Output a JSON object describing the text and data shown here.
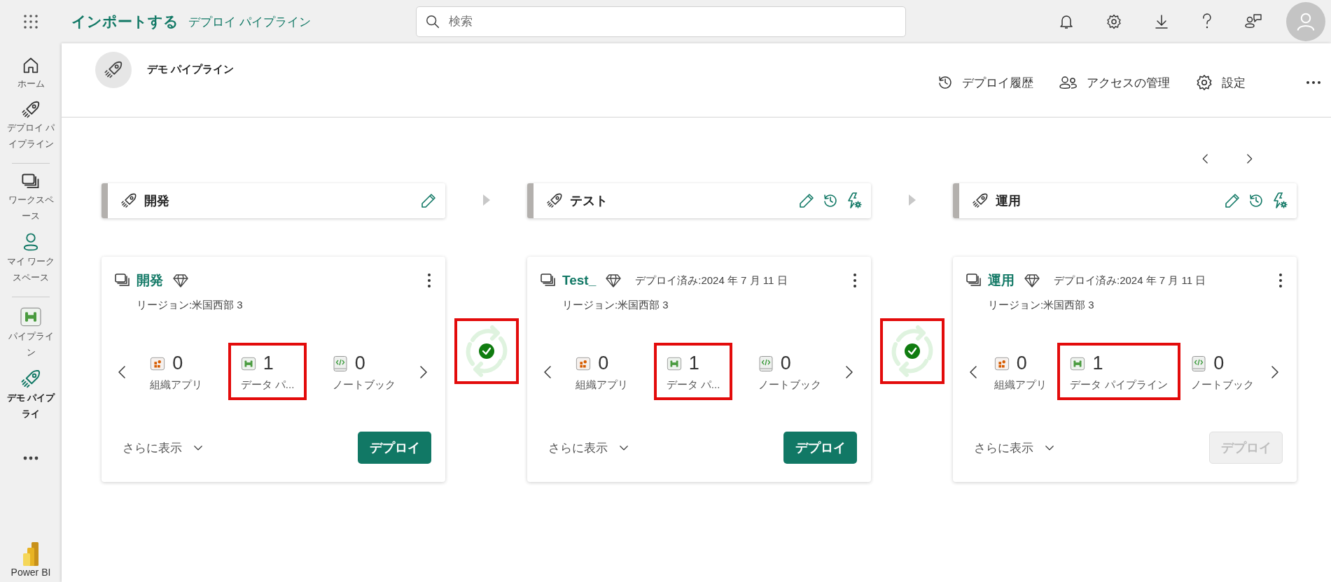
{
  "top_bar": {
    "brand": "インポートする",
    "breadcrumb": "デプロイ パイプライン",
    "search": {
      "placeholder": "検索"
    }
  },
  "sidebar": {
    "items": [
      {
        "kind": "home",
        "label": "ホーム",
        "selected": false
      },
      {
        "kind": "rocket",
        "label": "デプロイ パイプライン",
        "selected": false
      },
      {
        "kind": "divider"
      },
      {
        "kind": "workspaces",
        "label": "ワークスペース",
        "selected": false
      },
      {
        "kind": "person",
        "label": "マイ ワークスペース",
        "selected": false
      },
      {
        "kind": "divider"
      },
      {
        "kind": "pipeline",
        "label": "パイプライン",
        "selected": false
      },
      {
        "kind": "rocket-green",
        "label": "デモ パイプライ",
        "selected": true
      },
      {
        "kind": "more"
      }
    ],
    "footer": "Power BI"
  },
  "header": {
    "title": "デモ パイプライン",
    "actions": [
      {
        "kind": "history",
        "label": "デプロイ履歴"
      },
      {
        "kind": "people",
        "label": "アクセスの管理"
      },
      {
        "kind": "gear",
        "label": "設定"
      },
      {
        "kind": "more"
      }
    ]
  },
  "stages": [
    {
      "name": "開発",
      "tools": [
        {
          "kind": "edit"
        }
      ],
      "card": {
        "workspace": "開発",
        "region": "リージョン:米国西部 3",
        "items": [
          {
            "kind": "app",
            "count": "0",
            "label": "組織アプリ",
            "highlighted": false
          },
          {
            "kind": "pipeline",
            "count": "1",
            "label": "データ パ...",
            "highlighted": true
          },
          {
            "kind": "notebook",
            "count": "0",
            "label": "ノートブック",
            "highlighted": false
          }
        ],
        "more": "さらに表示",
        "deploy": {
          "label": "デプロイ",
          "disabled": false
        }
      }
    },
    {
      "name": "テスト",
      "tools": [
        {
          "kind": "edit"
        },
        {
          "kind": "history"
        },
        {
          "kind": "rules"
        }
      ],
      "card": {
        "workspace": "Test_",
        "deployed": "デプロイ済み:2024 年 7 月 11 日",
        "region": "リージョン:米国西部 3",
        "items": [
          {
            "kind": "app",
            "count": "0",
            "label": "組織アプリ",
            "highlighted": false
          },
          {
            "kind": "pipeline",
            "count": "1",
            "label": "データ パ...",
            "highlighted": true
          },
          {
            "kind": "notebook",
            "count": "0",
            "label": "ノートブック",
            "highlighted": false
          }
        ],
        "more": "さらに表示",
        "deploy": {
          "label": "デプロイ",
          "disabled": false
        }
      }
    },
    {
      "name": "運用",
      "tools": [
        {
          "kind": "edit"
        },
        {
          "kind": "history"
        },
        {
          "kind": "rules"
        }
      ],
      "card": {
        "workspace": "運用",
        "deployed": "デプロイ済み:2024 年 7 月 11 日",
        "region": "リージョン:米国西部 3",
        "items": [
          {
            "kind": "app",
            "count": "0",
            "label": "組織アプリ",
            "highlighted": false
          },
          {
            "kind": "pipeline",
            "count": "1",
            "label": "データ パイプライン",
            "highlighted": true
          },
          {
            "kind": "notebook",
            "count": "0",
            "label": "ノートブック",
            "highlighted": false
          }
        ],
        "more": "さらに表示",
        "deploy": {
          "label": "デプロイ",
          "disabled": true
        }
      }
    }
  ],
  "connectors": [
    {
      "kind": "synced",
      "highlighted": true
    },
    {
      "kind": "synced",
      "highlighted": true
    }
  ]
}
